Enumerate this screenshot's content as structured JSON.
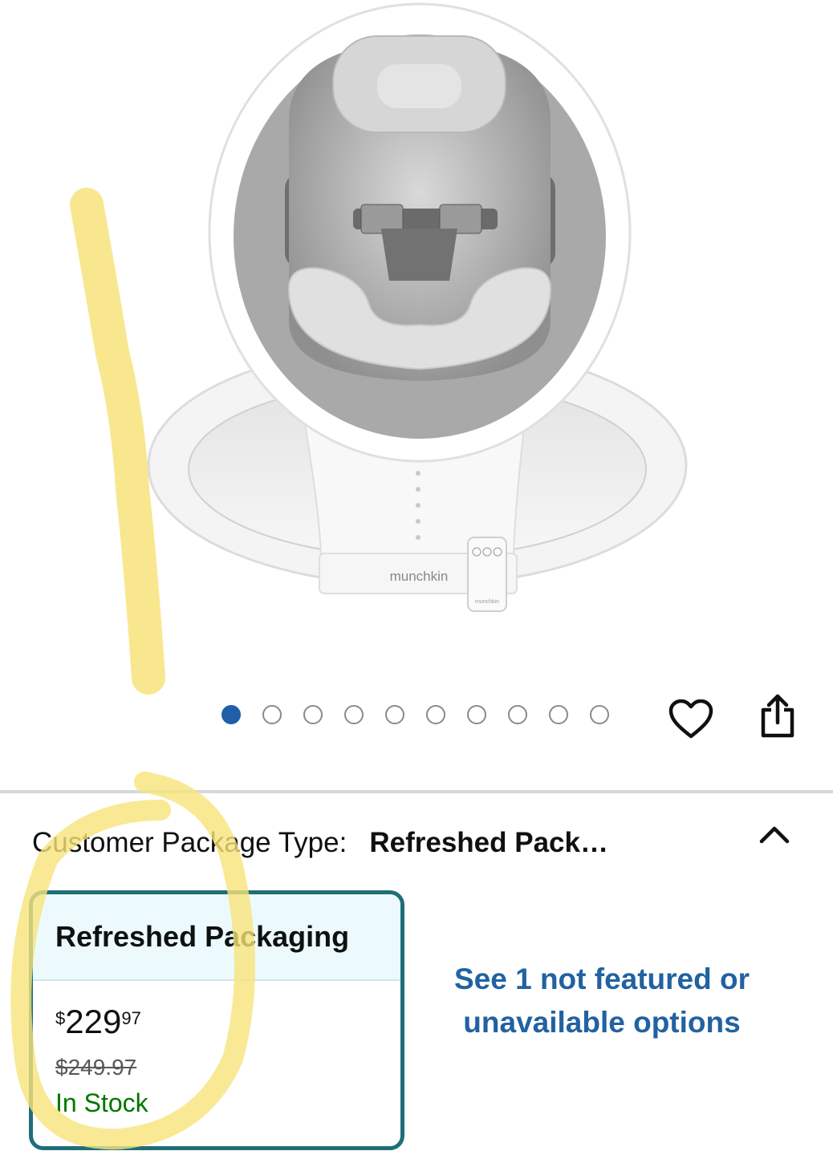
{
  "gallery": {
    "brand_text": "munchkin",
    "remote_text": "munchkin",
    "dot_count": 10,
    "active_dot": 1
  },
  "actions": {
    "favorite_icon": "heart-icon",
    "share_icon": "share-icon"
  },
  "variation": {
    "label": "Customer Package Type:",
    "selected_value": "Refreshed Pack…",
    "collapse_icon": "chevron-up-icon"
  },
  "option": {
    "title": "Refreshed Packaging",
    "price_symbol": "$",
    "price_whole": "229",
    "price_fraction": "97",
    "list_price": "$249.97",
    "stock_status": "In Stock"
  },
  "unavailable_link": "See 1 not featured or unavailable options",
  "colors": {
    "accent_link": "#2162a1",
    "card_border": "#1f6e78",
    "in_stock": "#007600",
    "active_dot": "#1f5fa8",
    "marker": "#f7e37a"
  }
}
